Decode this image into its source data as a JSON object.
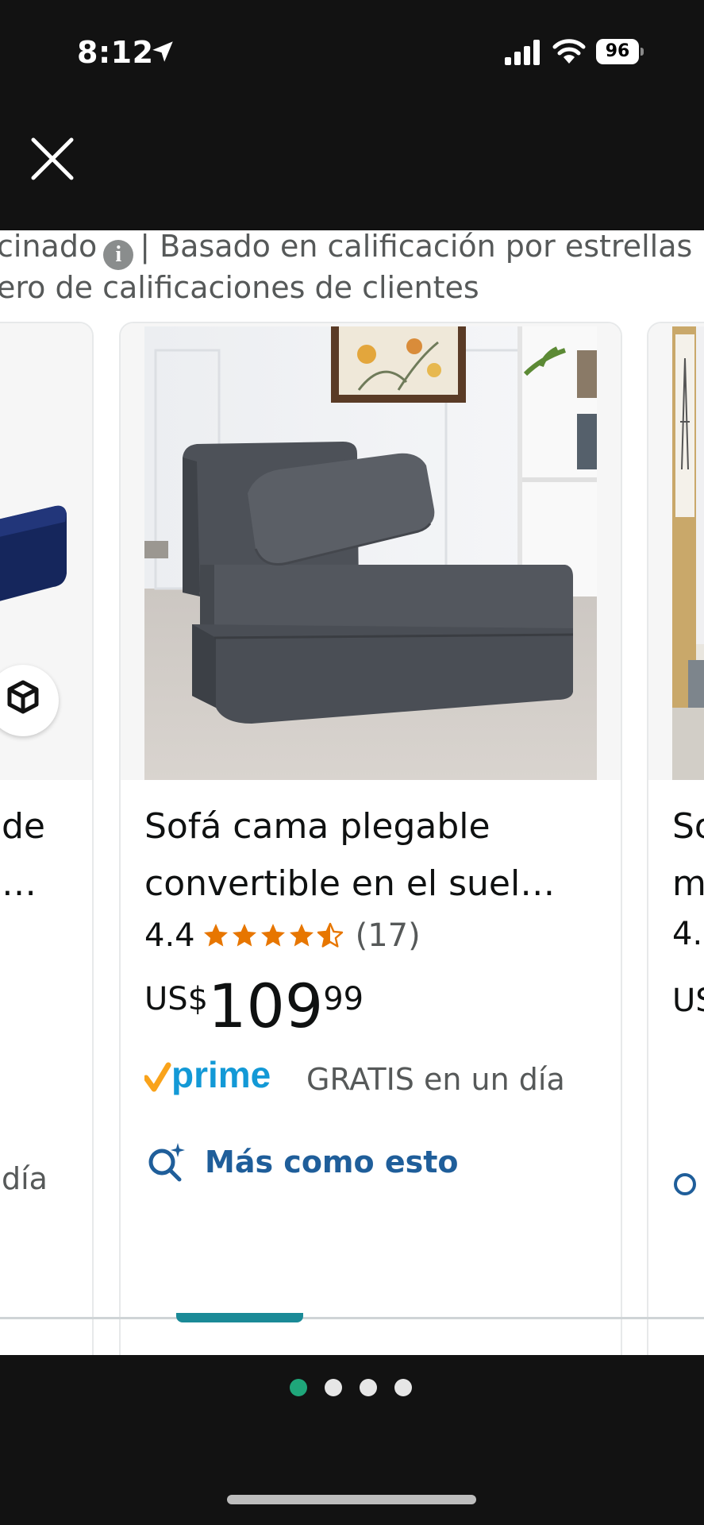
{
  "status_bar": {
    "time": "8:12",
    "battery": "96",
    "icons": [
      "location-arrow-icon",
      "cellular-signal-icon",
      "wifi-icon",
      "battery-icon"
    ]
  },
  "header": {
    "close_icon": "close-icon"
  },
  "info": {
    "line1_prefix": "cinado",
    "line1_suffix": "| Basado en calificación por estrellas",
    "line2": "ero de calificaciones de clientes",
    "info_icon_glyph": "i"
  },
  "cards": {
    "left": {
      "title_line1": "de",
      "title_line2": "…",
      "delivery_partial": "día"
    },
    "main": {
      "title": "Sofá cama plegable convertible en el suel…",
      "rating": "4.4",
      "stars_filled": 4.4,
      "rating_count": "(17)",
      "price_currency": "US$",
      "price_whole": "109",
      "price_fraction": "99",
      "prime_text": "GRATIS en un día",
      "more_like_this": "Más como esto"
    },
    "right": {
      "title_line1": "So",
      "title_line2": "m",
      "rating_partial": "4.",
      "price_partial": "US"
    }
  },
  "pagination": {
    "dots": 4,
    "active_index": 0
  },
  "colors": {
    "star": "#e77600",
    "prime_blue": "#1399d6",
    "prime_check": "#f9a31b",
    "link_blue": "#1f5e9a",
    "scroll_thumb": "#1a8a97",
    "active_dot": "#1fa67a"
  }
}
